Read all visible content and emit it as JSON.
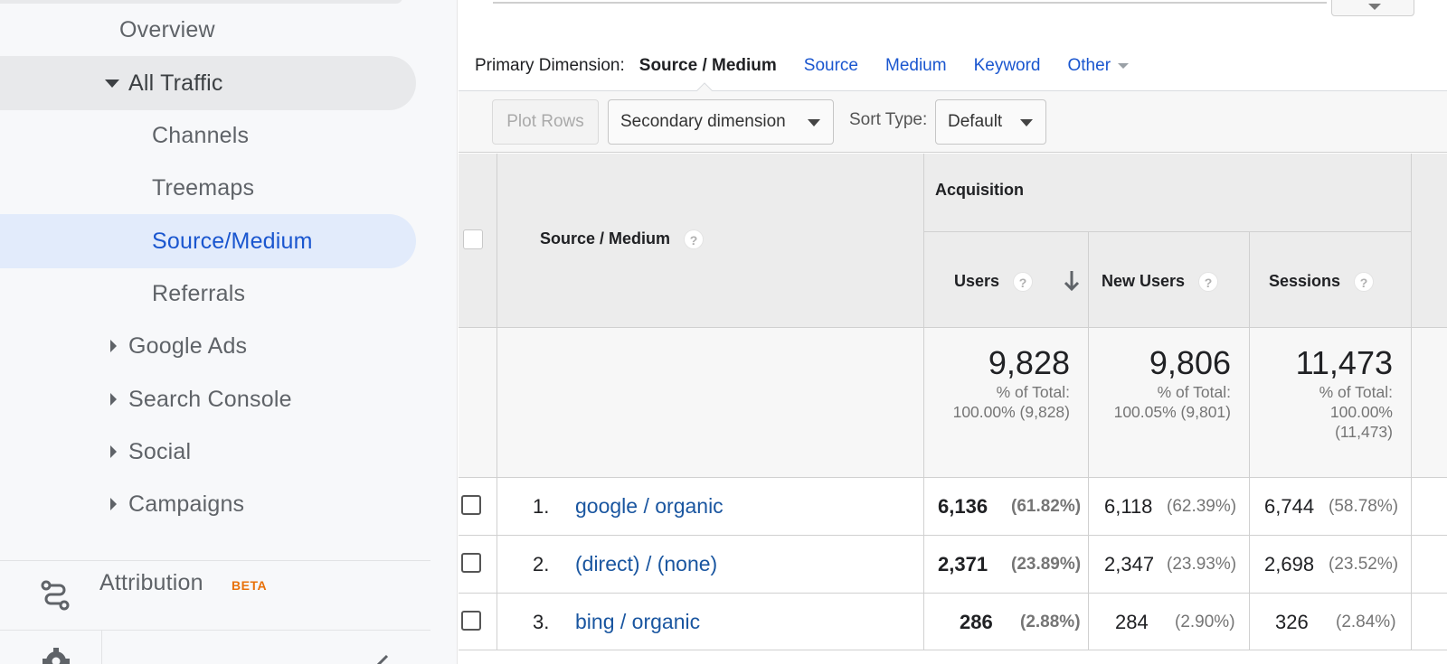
{
  "sidebar": {
    "items": [
      {
        "label": "Overview"
      },
      {
        "label": "All Traffic"
      },
      {
        "label": "Channels"
      },
      {
        "label": "Treemaps"
      },
      {
        "label": "Source/Medium"
      },
      {
        "label": "Referrals"
      },
      {
        "label": "Google Ads"
      },
      {
        "label": "Search Console"
      },
      {
        "label": "Social"
      },
      {
        "label": "Campaigns"
      }
    ],
    "attribution": {
      "label": "Attribution",
      "badge": "BETA"
    }
  },
  "primary_dimension": {
    "label": "Primary Dimension:",
    "active": "Source / Medium",
    "links": [
      "Source",
      "Medium",
      "Keyword"
    ],
    "other": "Other"
  },
  "toolbar": {
    "plot_rows": "Plot Rows",
    "secondary_dimension": "Secondary dimension",
    "sort_type_label": "Sort Type:",
    "sort_type_value": "Default"
  },
  "table": {
    "group_header": "Acquisition",
    "dimension_header": "Source / Medium",
    "columns": [
      "Users",
      "New Users",
      "Sessions"
    ],
    "help_glyph": "?",
    "totals": [
      {
        "value": "9,828",
        "line1": "% of Total:",
        "line2": "100.00% (9,828)",
        "line3": ""
      },
      {
        "value": "9,806",
        "line1": "% of Total:",
        "line2": "100.05% (9,801)",
        "line3": ""
      },
      {
        "value": "11,473",
        "line1": "% of Total:",
        "line2": "100.00%",
        "line3": "(11,473)"
      }
    ],
    "rows": [
      {
        "num": "1.",
        "name": "google / organic",
        "users": "6,136",
        "users_pct": "(61.82%)",
        "new_users": "6,118",
        "new_users_pct": "(62.39%)",
        "sessions": "6,744",
        "sessions_pct": "(58.78%)"
      },
      {
        "num": "2.",
        "name": "(direct) / (none)",
        "users": "2,371",
        "users_pct": "(23.89%)",
        "new_users": "2,347",
        "new_users_pct": "(23.93%)",
        "sessions": "2,698",
        "sessions_pct": "(23.52%)"
      },
      {
        "num": "3.",
        "name": "bing / organic",
        "users": "286",
        "users_pct": "(2.88%)",
        "new_users": "284",
        "new_users_pct": "(2.90%)",
        "sessions": "326",
        "sessions_pct": "(2.84%)"
      }
    ]
  },
  "colors": {
    "link": "#1a56cf",
    "row_link": "#1a56a0",
    "active_nav_bg": "#e2ebfb",
    "beta": "#e8710a"
  }
}
